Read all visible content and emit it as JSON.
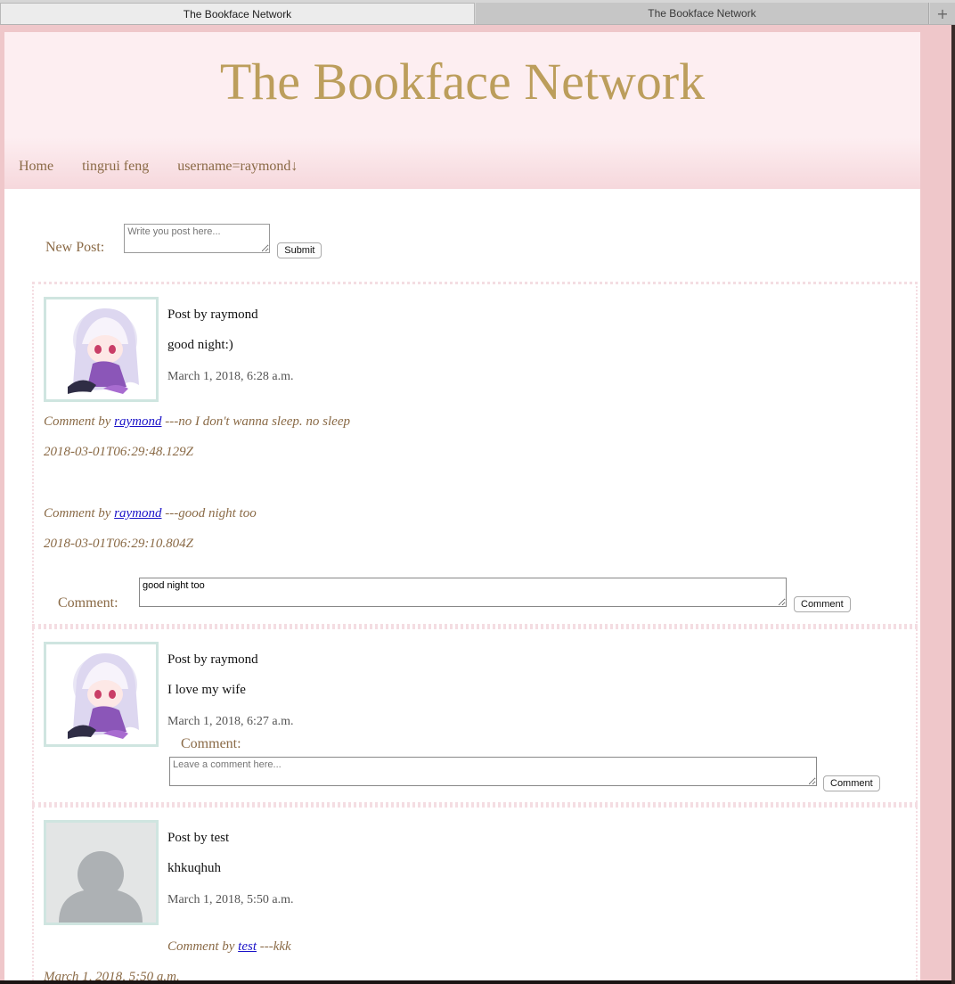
{
  "browser": {
    "tabs": [
      {
        "label": "The Bookface Network"
      },
      {
        "label": "The Bookface Network"
      }
    ],
    "new_tab_icon": "plus-icon"
  },
  "site": {
    "title": "The Bookface Network",
    "nav": [
      "Home",
      "tingrui feng",
      "username=raymond↓"
    ]
  },
  "new_post": {
    "label": "New Post:",
    "placeholder": "Write you post here...",
    "submit_label": "Submit"
  },
  "posts": [
    {
      "author_line": "Post by raymond",
      "body": "good night:)",
      "time": "March 1, 2018, 6:28 a.m.",
      "comments": [
        {
          "prefix": "Comment by",
          "user": "raymond",
          "text": "---no I don't wanna sleep. no sleep",
          "time": "2018-03-01T06:29:48.129Z"
        },
        {
          "prefix": "Comment by",
          "user": "raymond",
          "text": "---good night too",
          "time": "2018-03-01T06:29:10.804Z"
        }
      ],
      "comment_label": "Comment:",
      "comment_value": "good night too",
      "comment_button": "Comment"
    },
    {
      "author_line": "Post by raymond",
      "body": "I love my wife",
      "time": "March 1, 2018, 6:27 a.m.",
      "comment_label": "Comment:",
      "comment_placeholder": "Leave a comment here...",
      "comment_button": "Comment"
    },
    {
      "author_line": "Post by test",
      "body": "khkuqhuh",
      "time": "March 1, 2018, 5:50 a.m.",
      "comments": [
        {
          "prefix": "Comment by",
          "user": "test",
          "text": "---kkk",
          "time": "March 1, 2018, 5:50 a.m."
        }
      ]
    }
  ],
  "colors": {
    "title_gold": "#bc9e5c",
    "nav_brown": "#8a6a46",
    "header_pink": "#fdeef1",
    "avatar_border": "#cfe5e0",
    "link_blue": "#1a12c8"
  }
}
